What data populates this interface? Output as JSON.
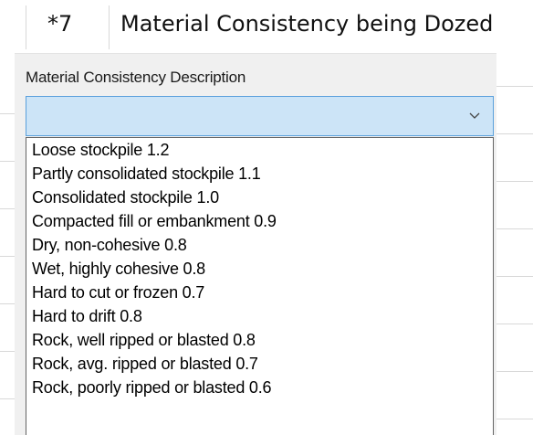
{
  "header": {
    "row_number": "*7",
    "row_title": "Material Consistency being Dozed"
  },
  "field": {
    "label": "Material Consistency Description",
    "selected_value": ""
  },
  "icons": {
    "dropdown_arrow": "chevron-down-icon"
  },
  "colors": {
    "combo_bg": "#cce4f7",
    "combo_border": "#5aa0dc",
    "panel_bg": "#f0f0f0"
  },
  "options": [
    "Loose stockpile 1.2",
    "Partly consolidated stockpile 1.1",
    "Consolidated stockpile 1.0",
    "Compacted fill or embankment 0.9",
    "Dry, non-cohesive 0.8",
    "Wet, highly cohesive 0.8",
    "Hard to cut or frozen 0.7",
    "Hard to drift 0.8",
    "Rock, well ripped or blasted 0.8",
    "Rock, avg. ripped or blasted 0.7",
    "Rock, poorly ripped or blasted 0.6"
  ]
}
